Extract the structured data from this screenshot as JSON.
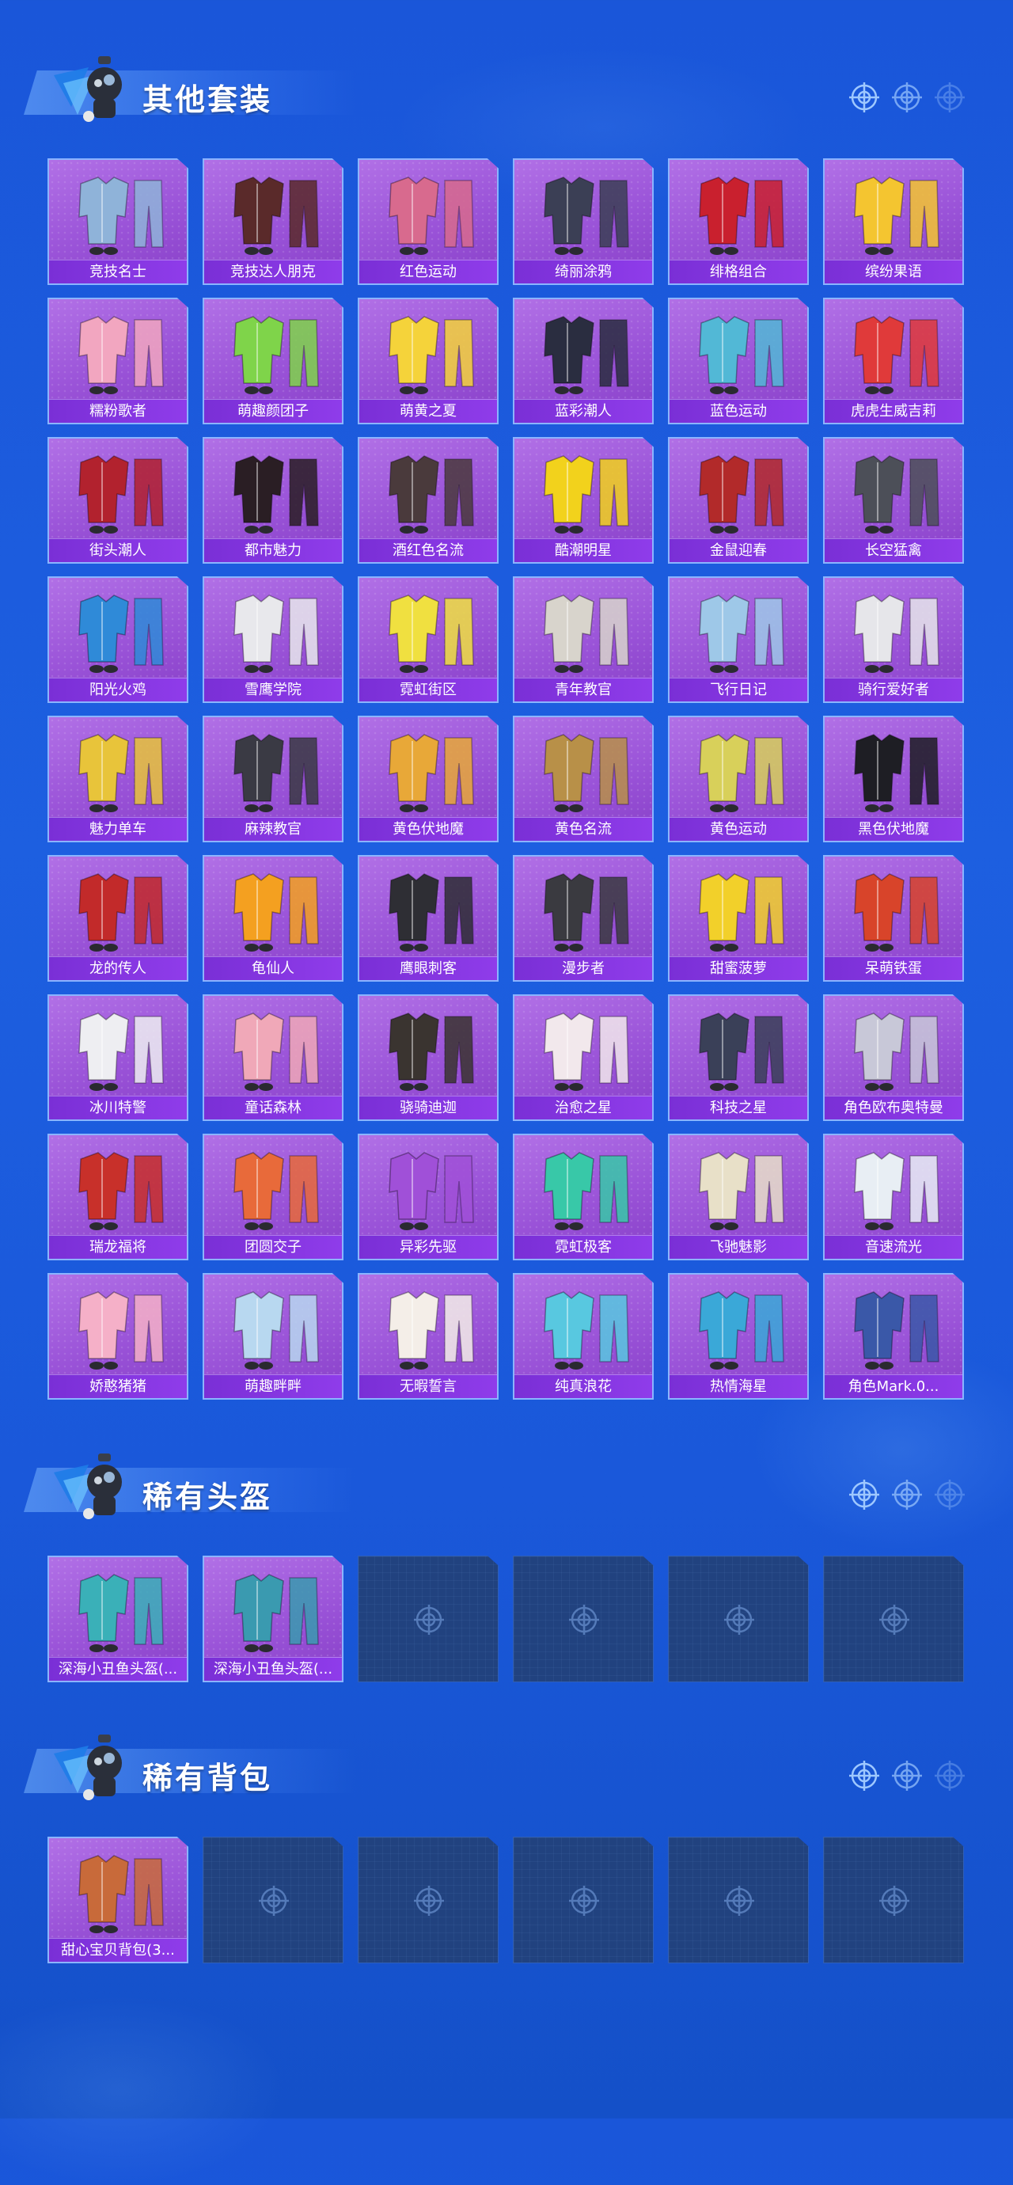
{
  "sections": {
    "outfits": {
      "title": "其他套装",
      "items": [
        {
          "name": "竞技名士",
          "color": "#8fb3d9"
        },
        {
          "name": "竞技达人朋克",
          "color": "#5a2a2a"
        },
        {
          "name": "红色运动",
          "color": "#d86a8e"
        },
        {
          "name": "绮丽涂鸦",
          "color": "#3b3f55"
        },
        {
          "name": "绯格组合",
          "color": "#c9202e"
        },
        {
          "name": "缤纷果语",
          "color": "#f4c530"
        },
        {
          "name": "糯粉歌者",
          "color": "#f2a6c0"
        },
        {
          "name": "萌趣颜团子",
          "color": "#7fd44a"
        },
        {
          "name": "萌黄之夏",
          "color": "#f5d33a"
        },
        {
          "name": "蓝彩潮人",
          "color": "#2a2d40"
        },
        {
          "name": "蓝色运动",
          "color": "#52b8d6"
        },
        {
          "name": "虎虎生威吉莉",
          "color": "#e03a3a"
        },
        {
          "name": "街头潮人",
          "color": "#b2222e"
        },
        {
          "name": "都市魅力",
          "color": "#2a1e24"
        },
        {
          "name": "酒红色名流",
          "color": "#4a3a3c"
        },
        {
          "name": "酷潮明星",
          "color": "#f2d21c"
        },
        {
          "name": "金鼠迎春",
          "color": "#b22a2a"
        },
        {
          "name": "长空猛禽",
          "color": "#4c4f58"
        },
        {
          "name": "阳光火鸡",
          "color": "#2f8ad8"
        },
        {
          "name": "雪鹰学院",
          "color": "#e8e8ec"
        },
        {
          "name": "霓虹街区",
          "color": "#f0e040"
        },
        {
          "name": "青年教官",
          "color": "#d8d4cc"
        },
        {
          "name": "飞行日记",
          "color": "#9ec8e8"
        },
        {
          "name": "骑行爱好者",
          "color": "#e6e6ea"
        },
        {
          "name": "魅力单车",
          "color": "#e8c43a"
        },
        {
          "name": "麻辣教官",
          "color": "#3a3a44"
        },
        {
          "name": "黄色伏地魔",
          "color": "#e8a838"
        },
        {
          "name": "黄色名流",
          "color": "#b89048"
        },
        {
          "name": "黄色运动",
          "color": "#d8d05a"
        },
        {
          "name": "黑色伏地魔",
          "color": "#1e1e24"
        },
        {
          "name": "龙的传人",
          "color": "#c22a2a"
        },
        {
          "name": "龟仙人",
          "color": "#f4a020"
        },
        {
          "name": "鹰眼刺客",
          "color": "#2e2e34"
        },
        {
          "name": "漫步者",
          "color": "#3a3a40"
        },
        {
          "name": "甜蜜菠萝",
          "color": "#f2d02a"
        },
        {
          "name": "呆萌铁蛋",
          "color": "#d8442a"
        },
        {
          "name": "冰川特警",
          "color": "#eeeef2"
        },
        {
          "name": "童话森林",
          "color": "#f0a8b8"
        },
        {
          "name": "骁骑迪迦",
          "color": "#3a3430"
        },
        {
          "name": "治愈之星",
          "color": "#f2e8ec"
        },
        {
          "name": "科技之星",
          "color": "#3a4058"
        },
        {
          "name": "角色欧布奥特曼",
          "color": "#c8c8d8"
        },
        {
          "name": "瑞龙福将",
          "color": "#c8302a"
        },
        {
          "name": "团圆交子",
          "color": "#e86a3a"
        },
        {
          "name": "异彩先驱",
          "color": "#a050d8"
        },
        {
          "name": "霓虹极客",
          "color": "#38c8a8"
        },
        {
          "name": "飞驰魅影",
          "color": "#e8e0c8"
        },
        {
          "name": "音速流光",
          "color": "#e8eef4"
        },
        {
          "name": "娇憨猪猪",
          "color": "#f5b0c8"
        },
        {
          "name": "萌趣畔畔",
          "color": "#b8d8f0"
        },
        {
          "name": "无暇誓言",
          "color": "#f4eee8"
        },
        {
          "name": "纯真浪花",
          "color": "#58c8e0"
        },
        {
          "name": "热情海星",
          "color": "#3aa8d8"
        },
        {
          "name": "角色Mark.0...",
          "color": "#3a58a8"
        }
      ]
    },
    "helmets": {
      "title": "稀有头盔",
      "items": [
        {
          "name": "深海小丑鱼头盔(...",
          "color": "#3ab0b8"
        },
        {
          "name": "深海小丑鱼头盔(...",
          "color": "#3a9ab0"
        }
      ],
      "empty_slots": 4
    },
    "backpacks": {
      "title": "稀有背包",
      "items": [
        {
          "name": "甜心宝贝背包(3...",
          "color": "#c86a3a"
        }
      ],
      "empty_slots": 5
    }
  },
  "icons": {
    "header_mascot": "mascot-icon",
    "target": "crosshair-icon",
    "empty_slot": "crosshair-icon"
  }
}
